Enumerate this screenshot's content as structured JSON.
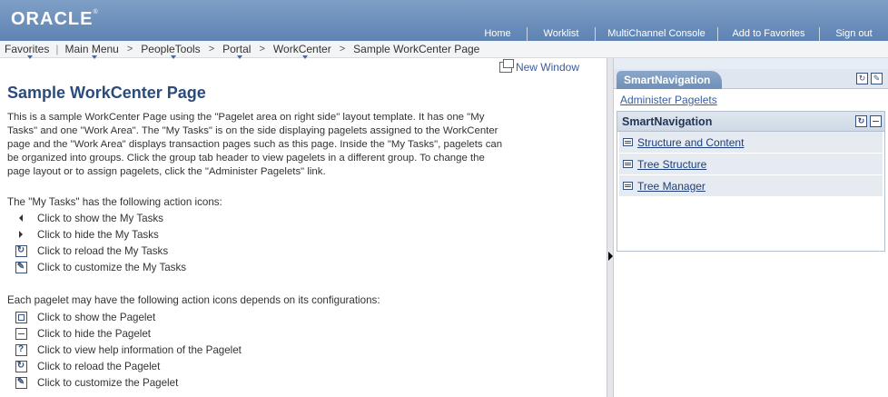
{
  "header": {
    "logo": "ORACLE",
    "links": [
      "Home",
      "Worklist",
      "MultiChannel Console",
      "Add to Favorites",
      "Sign out"
    ]
  },
  "nav": {
    "favorites": "Favorites",
    "main_menu": "Main Menu",
    "crumbs": [
      "PeopleTools",
      "Portal",
      "WorkCenter",
      "Sample WorkCenter Page"
    ]
  },
  "main": {
    "new_window": "New Window",
    "title": "Sample WorkCenter Page",
    "intro": "This is a sample WorkCenter Page using the \"Pagelet area on right side\" layout template. It has one \"My Tasks\" and one \"Work Area\". The \"My Tasks\" is on the side displaying pagelets assigned to the WorkCenter page and the \"Work Area\" displays transaction pages such as this page. Inside the \"My Tasks\", pagelets can be organized into groups. Click the group tab header to view pagelets in a different group. To change the page layout or to assign pagelets, click the \"Administer Pagelets\" link.",
    "mytasks_heading": "The \"My Tasks\" has the following action icons:",
    "mytasks_actions": [
      "Click to show the My Tasks",
      "Click to hide the My Tasks",
      "Click to reload the My Tasks",
      "Click to customize the My Tasks"
    ],
    "pagelet_heading": "Each pagelet may have the following action icons depends on its configurations:",
    "pagelet_actions": [
      "Click to show the Pagelet",
      "Click to hide the Pagelet",
      "Click to view help information of the Pagelet",
      "Click to reload the Pagelet",
      "Click to customize the Pagelet"
    ]
  },
  "right": {
    "tab": "SmartNavigation",
    "admin_link": "Administer Pagelets",
    "pagelet_title": "SmartNavigation",
    "items": [
      "Structure and Content",
      "Tree Structure",
      "Tree Manager"
    ]
  },
  "colors": {
    "header": "#6b8dba",
    "title": "#2b4b7c",
    "link": "#1f3e7a"
  }
}
